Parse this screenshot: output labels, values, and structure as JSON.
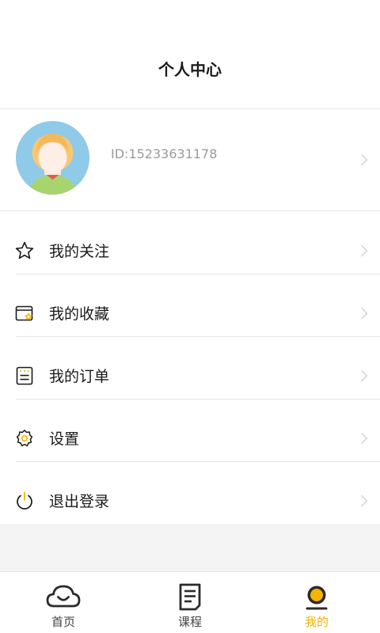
{
  "header": {
    "title": "个人中心"
  },
  "profile": {
    "id_text": "ID:15233631178"
  },
  "menu": {
    "items": [
      {
        "label": "我的关注",
        "icon": "star-icon"
      },
      {
        "label": "我的收藏",
        "icon": "favorites-folder-icon"
      },
      {
        "label": "我的订单",
        "icon": "order-list-icon"
      },
      {
        "label": "设置",
        "icon": "gear-icon"
      },
      {
        "label": "退出登录",
        "icon": "power-icon"
      }
    ]
  },
  "tabbar": {
    "items": [
      {
        "label": "首页",
        "icon": "cloud-home-icon"
      },
      {
        "label": "课程",
        "icon": "course-document-icon"
      },
      {
        "label": "我的",
        "icon": "profile-circle-icon",
        "active": true
      }
    ]
  },
  "colors": {
    "accent": "#f5b400",
    "divider": "#e6e6e6",
    "id_text": "#9a9a9a"
  }
}
